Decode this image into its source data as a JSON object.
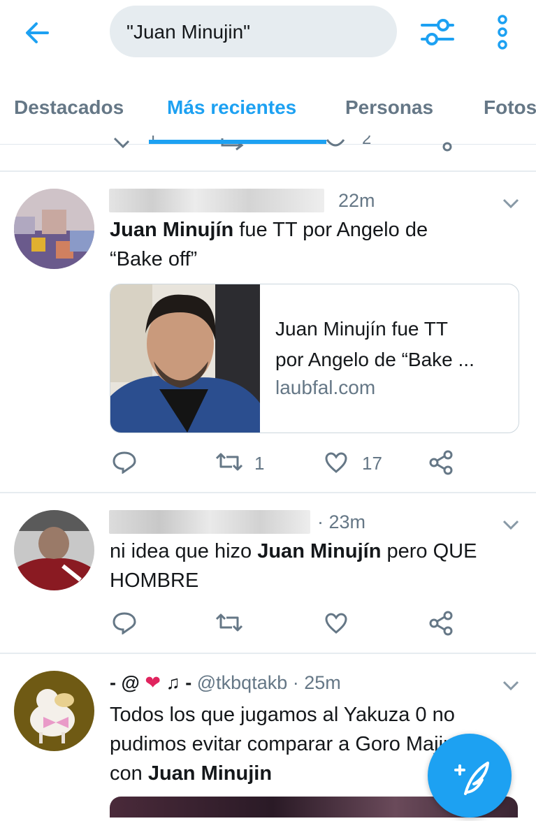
{
  "search": {
    "query": "\"Juan Minujin\""
  },
  "tabs": [
    {
      "label": "Destacados"
    },
    {
      "label": "Más recientes"
    },
    {
      "label": "Personas"
    },
    {
      "label": "Fotos"
    }
  ],
  "partial_actions": {
    "retweets": "1",
    "likes": "2"
  },
  "tweets": [
    {
      "time": "22m",
      "text_bold": "Juan Minujín",
      "text_rest": " fue TT por Angelo de",
      "text_line2": "“Bake off”",
      "card": {
        "title_line1": "Juan Minujín fue TT",
        "title_line2": "por Angelo de “Bake ...",
        "domain": "laubfal.com"
      },
      "retweets": "1",
      "likes": "17"
    },
    {
      "time": "· 23m",
      "text_pre": "ni idea que hizo ",
      "text_bold": "Juan Minujín",
      "text_post": " pero QUE",
      "text_line2": "HOMBRE"
    },
    {
      "name_pre": "- @",
      "name_post": "♫ -",
      "handle": "@tkbqtakb",
      "time": "· 25m",
      "line1": "Todos los que jugamos al Yakuza 0 no",
      "line2": "pudimos evitar comparar a Goro Majima",
      "line3_pre": "con ",
      "line3_bold": "Juan Minujin"
    }
  ],
  "colors": {
    "accent": "#1da1f2",
    "muted": "#657786",
    "text": "#14171a",
    "like_heart": "#e0245e"
  }
}
